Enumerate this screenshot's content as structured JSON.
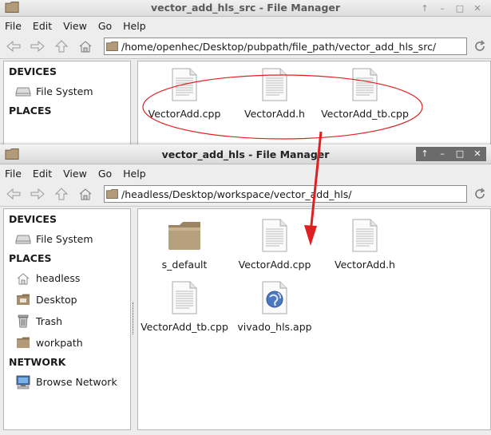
{
  "colors": {
    "annotation_red": "#e02020",
    "folder_brown": "#b39a78",
    "selection": "#ffffff"
  },
  "back_window": {
    "title": "vector_add_hls_src - File Manager",
    "window_buttons": [
      "↑",
      "–",
      "□",
      "✕"
    ],
    "menus": [
      "File",
      "Edit",
      "View",
      "Go",
      "Help"
    ],
    "location": "/home/openhec/Desktop/pubpath/file_path/vector_add_hls_src/",
    "sidebar": {
      "devices_header": "DEVICES",
      "devices": [
        {
          "label": "File System",
          "icon": "drive-icon"
        }
      ],
      "places_header": "PLACES"
    },
    "files": [
      {
        "name": "VectorAdd.cpp",
        "icon": "text-file-icon"
      },
      {
        "name": "VectorAdd.h",
        "icon": "text-file-icon"
      },
      {
        "name": "VectorAdd_tb.cpp",
        "icon": "text-file-icon"
      }
    ]
  },
  "front_window": {
    "title": "vector_add_hls - File Manager",
    "window_buttons": [
      "↑",
      "–",
      "□",
      "✕"
    ],
    "menus": [
      "File",
      "Edit",
      "View",
      "Go",
      "Help"
    ],
    "location": "/headless/Desktop/workspace/vector_add_hls/",
    "sidebar": {
      "devices_header": "DEVICES",
      "devices": [
        {
          "label": "File System",
          "icon": "drive-icon"
        }
      ],
      "places_header": "PLACES",
      "places": [
        {
          "label": "headless",
          "icon": "home-icon"
        },
        {
          "label": "Desktop",
          "icon": "desktop-folder-icon"
        },
        {
          "label": "Trash",
          "icon": "trash-icon"
        },
        {
          "label": "workpath",
          "icon": "folder-icon"
        }
      ],
      "network_header": "NETWORK",
      "network": [
        {
          "label": "Browse Network",
          "icon": "network-icon"
        }
      ]
    },
    "files": [
      {
        "name": "s_default",
        "icon": "folder-icon"
      },
      {
        "name": "VectorAdd.cpp",
        "icon": "text-file-icon"
      },
      {
        "name": "VectorAdd.h",
        "icon": "text-file-icon"
      },
      {
        "name": "VectorAdd_tb.cpp",
        "icon": "text-file-icon"
      },
      {
        "name": "vivado_hls.app",
        "icon": "app-globe-icon"
      }
    ]
  }
}
